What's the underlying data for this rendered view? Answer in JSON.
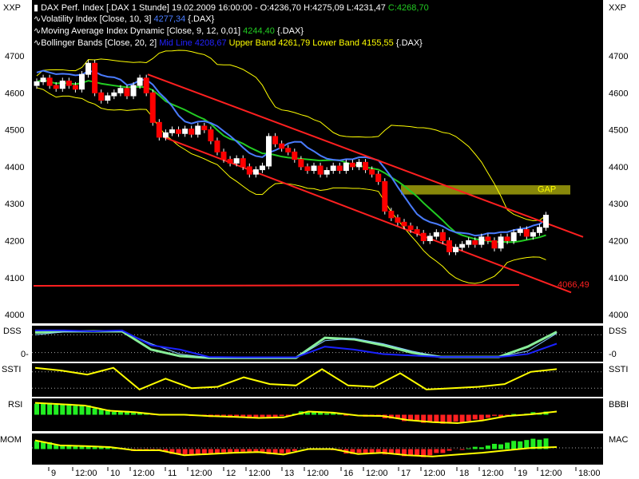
{
  "scale_label_left": "XXP",
  "scale_label_right": "XXP",
  "header": {
    "line1": "DAX Perf. Index [.DAX  1 Stunde] 19.02.2009 16:00:00 - O:4236,70 H:4275,09 L:4231,47 ",
    "line1_close": "C:4268,70",
    "line2": "Volatility Index [Close, 10, 3] ",
    "line2_val": "4277,34",
    "line2_tail": " {.DAX}",
    "line3": "Moving Average Index Dynamic [Close, 9, 12, 0,01] ",
    "line3_val": "4244,40",
    "line3_tail": " {.DAX}",
    "line4": "Bollinger Bands [Close, 20, 2] ",
    "line4_mid": "Mid Line 4208,67",
    "line4_bands": " Upper Band 4261,79 Lower Band 4155,55",
    "line4_tail": " {.DAX}"
  },
  "colors": {
    "up": "#ffffff",
    "down": "#ff0000",
    "volatility": "#4a7cff",
    "ma": "#22cc22",
    "boll": "#ffff00",
    "channel": "#ff2020",
    "gap": "#88880a"
  },
  "annotations": {
    "gap_label": "GAP",
    "support_label": "4066,49"
  },
  "panel_labels": {
    "dss_left": "DSS",
    "dss_right": "DSS",
    "dss_zero_left": "0-",
    "dss_zero_right": "-0",
    "ssti_left": "SSTI",
    "ssti_right": "SSTI",
    "rsi_left": "RSI",
    "bbbi_right": "BBBI",
    "mom_left": "MOM",
    "mac_right": "MAC"
  },
  "chart_data": {
    "type": "candlestick",
    "title": "DAX Perf. Index [.DAX 1 Stunde]",
    "ylim": [
      3950,
      4760
    ],
    "yticks": [
      "4700",
      "4600",
      "4500",
      "4400",
      "4300",
      "4200",
      "4100",
      "4000"
    ],
    "ytick_values": [
      4700,
      4600,
      4500,
      4400,
      4300,
      4200,
      4100,
      4000
    ],
    "xticks": [
      "9",
      "12:00",
      "10",
      "12:00",
      "11",
      "12:00",
      "12",
      "12:00",
      "13",
      "12:00",
      "16",
      "12:00",
      "17",
      "12:00",
      "18",
      "12:00",
      "19",
      "12:00",
      "18:00"
    ],
    "close": [
      4630,
      4640,
      4620,
      4612,
      4632,
      4620,
      4610,
      4650,
      4680,
      4600,
      4580,
      4592,
      4600,
      4612,
      4592,
      4620,
      4640,
      4600,
      4520,
      4480,
      4492,
      4500,
      4490,
      4502,
      4488,
      4510,
      4500,
      4470,
      4440,
      4420,
      4410,
      4422,
      4400,
      4380,
      4392,
      4402,
      4482,
      4462,
      4450,
      4440,
      4420,
      4400,
      4390,
      4402,
      4380,
      4390,
      4402,
      4390,
      4410,
      4400,
      4412,
      4392,
      4380,
      4360,
      4280,
      4262,
      4250,
      4240,
      4230,
      4220,
      4200,
      4212,
      4222,
      4200,
      4170,
      4182,
      4190,
      4200,
      4190,
      4210,
      4200,
      4180,
      4210,
      4200,
      4222,
      4230,
      4212,
      4222,
      4236,
      4269
    ],
    "channel": {
      "upper": [
        4650,
        4210
      ],
      "lower": [
        4480,
        4060
      ]
    },
    "support_level": 4080,
    "gap_zone": [
      4325,
      4350
    ],
    "dss": {
      "ylim": [
        0,
        100
      ],
      "green": [
        88,
        92,
        92,
        92,
        30,
        8,
        2,
        2,
        2,
        2,
        70,
        65,
        45,
        20,
        5,
        5,
        5,
        40,
        90
      ],
      "lightblue": [
        80,
        90,
        92,
        92,
        50,
        15,
        3,
        2,
        2,
        2,
        60,
        68,
        50,
        25,
        5,
        5,
        5,
        25,
        85
      ],
      "blue": [
        95,
        95,
        92,
        95,
        45,
        30,
        5,
        4,
        4,
        4,
        40,
        30,
        15,
        10,
        5,
        5,
        5,
        15,
        50
      ]
    },
    "ssti": {
      "ylim": [
        0,
        100
      ],
      "yellow": [
        95,
        85,
        70,
        95,
        15,
        55,
        20,
        25,
        60,
        35,
        30,
        90,
        30,
        25,
        75,
        15,
        20,
        25,
        35,
        80,
        90
      ]
    },
    "rsi_bbbi": {
      "ylim": [
        -50,
        50
      ],
      "yellow": [
        45,
        40,
        35,
        15,
        10,
        0,
        0,
        -5,
        -8,
        -12,
        -10,
        12,
        8,
        -3,
        -5,
        -20,
        -28,
        -32,
        -22,
        -5,
        2,
        12
      ]
    },
    "mom_mac": {
      "ylim": [
        -50,
        50
      ],
      "yellow": [
        35,
        15,
        12,
        8,
        -5,
        -5,
        -25,
        -20,
        -15,
        -12,
        -22,
        0,
        0,
        -20,
        -15,
        -25,
        -30,
        -22,
        -15,
        -5,
        5,
        8
      ]
    }
  }
}
